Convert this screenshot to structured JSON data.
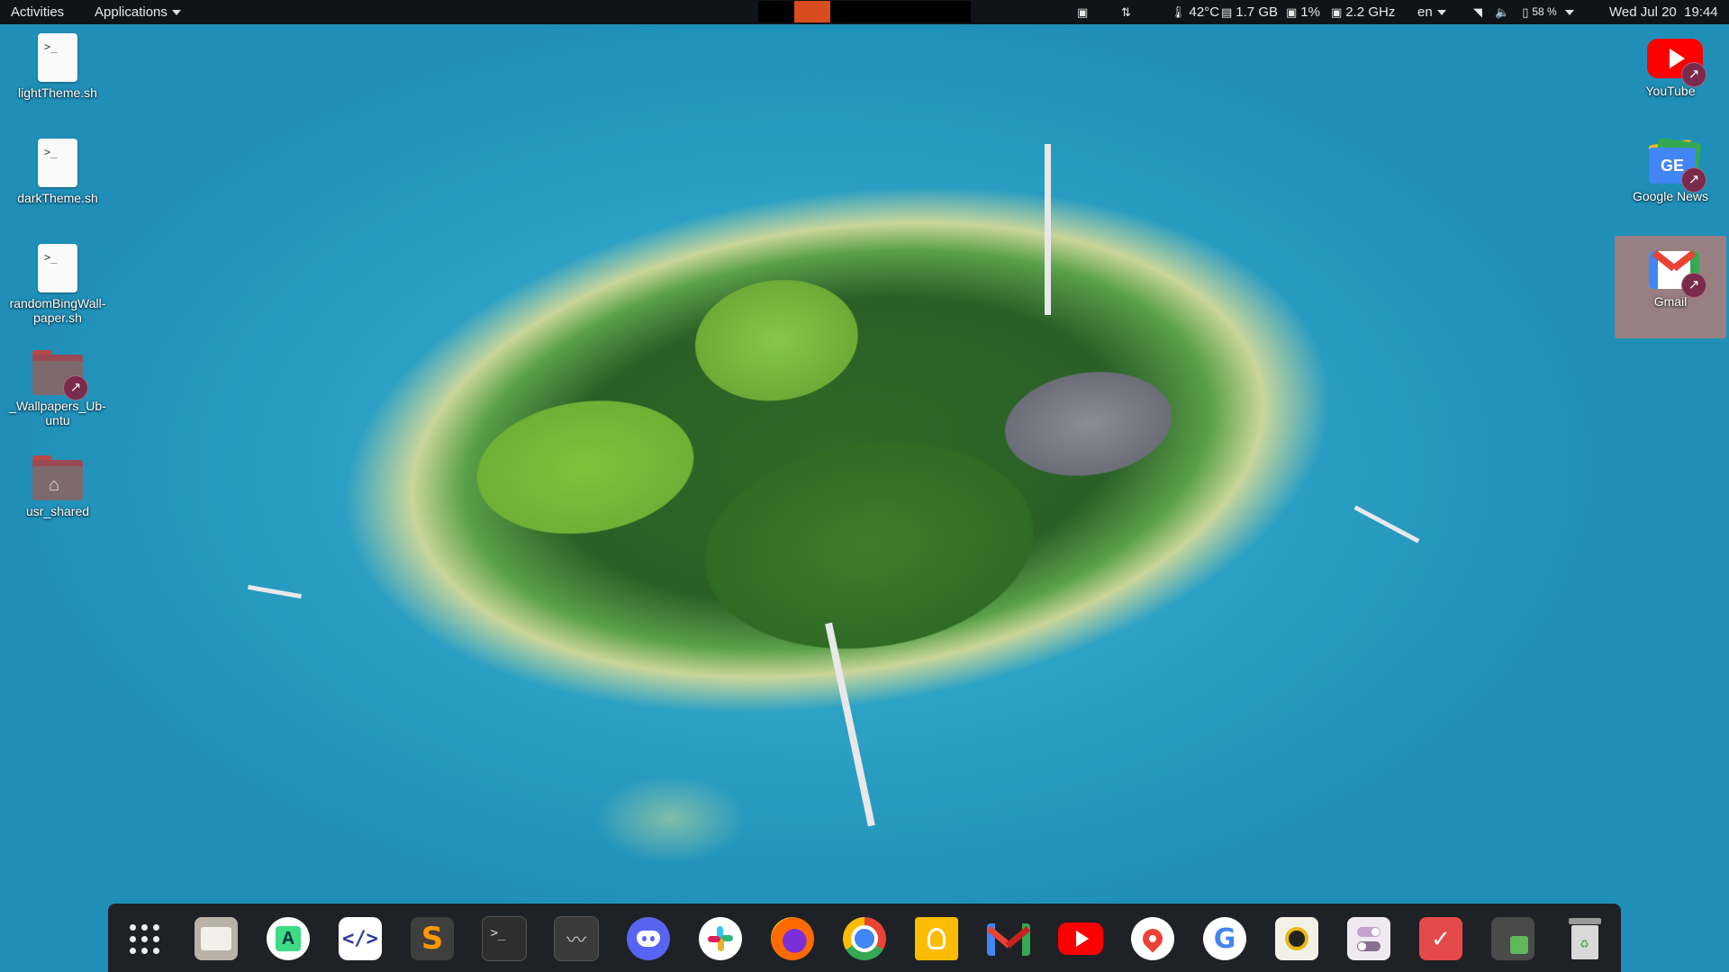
{
  "top_panel": {
    "activities": "Activities",
    "applications": "Applications",
    "indicators": {
      "temperature": "42°C",
      "memory": "1.7 GB",
      "cpu_load": "1%",
      "cpu_freq": "2.2 GHz",
      "keyboard_layout": "en",
      "battery": "58 %",
      "datetime": "Wed Jul 20  19:44"
    }
  },
  "desktop_left": [
    {
      "label": "lightTheme.sh",
      "icon": "script-file-icon"
    },
    {
      "label": "darkTheme.sh",
      "icon": "script-file-icon"
    },
    {
      "label": "randomBingWall-paper.sh",
      "icon": "script-file-icon"
    },
    {
      "label": "_Wallpapers_Ub-untu",
      "icon": "folder-link-icon"
    },
    {
      "label": "usr_shared",
      "icon": "home-folder-icon"
    }
  ],
  "desktop_right": [
    {
      "label": "YouTube",
      "icon": "youtube-icon"
    },
    {
      "label": "Google News",
      "icon": "google-news-icon"
    },
    {
      "label": "Gmail",
      "icon": "gmail-icon"
    }
  ],
  "dock": {
    "items": [
      {
        "name": "app-grid",
        "icon": "app-grid-icon"
      },
      {
        "name": "files",
        "icon": "files-icon"
      },
      {
        "name": "android-studio",
        "icon": "android-studio-icon"
      },
      {
        "name": "code-editor",
        "icon": "code-editor-icon"
      },
      {
        "name": "sublime-text",
        "icon": "sublime-text-icon"
      },
      {
        "name": "terminal",
        "icon": "terminal-icon"
      },
      {
        "name": "system-monitor",
        "icon": "system-monitor-icon"
      },
      {
        "name": "discord",
        "icon": "discord-icon"
      },
      {
        "name": "slack",
        "icon": "slack-icon"
      },
      {
        "name": "firefox",
        "icon": "firefox-icon"
      },
      {
        "name": "chrome",
        "icon": "chrome-icon"
      },
      {
        "name": "keep",
        "icon": "keep-icon"
      },
      {
        "name": "gmail",
        "icon": "gmail-icon"
      },
      {
        "name": "youtube",
        "icon": "youtube-icon"
      },
      {
        "name": "maps",
        "icon": "maps-icon"
      },
      {
        "name": "google",
        "icon": "google-icon"
      },
      {
        "name": "rhythmbox",
        "icon": "rhythmbox-icon"
      },
      {
        "name": "tweaks",
        "icon": "tweaks-icon"
      },
      {
        "name": "todo",
        "icon": "todo-icon"
      },
      {
        "name": "extensions",
        "icon": "extensions-icon"
      },
      {
        "name": "trash",
        "icon": "trash-icon"
      }
    ]
  },
  "colors": {
    "panel": "#101418",
    "dock": "#1e2226",
    "water": "#2aa0c4",
    "selection": "#c8786e",
    "active_window_marker": "#d94c1e"
  }
}
